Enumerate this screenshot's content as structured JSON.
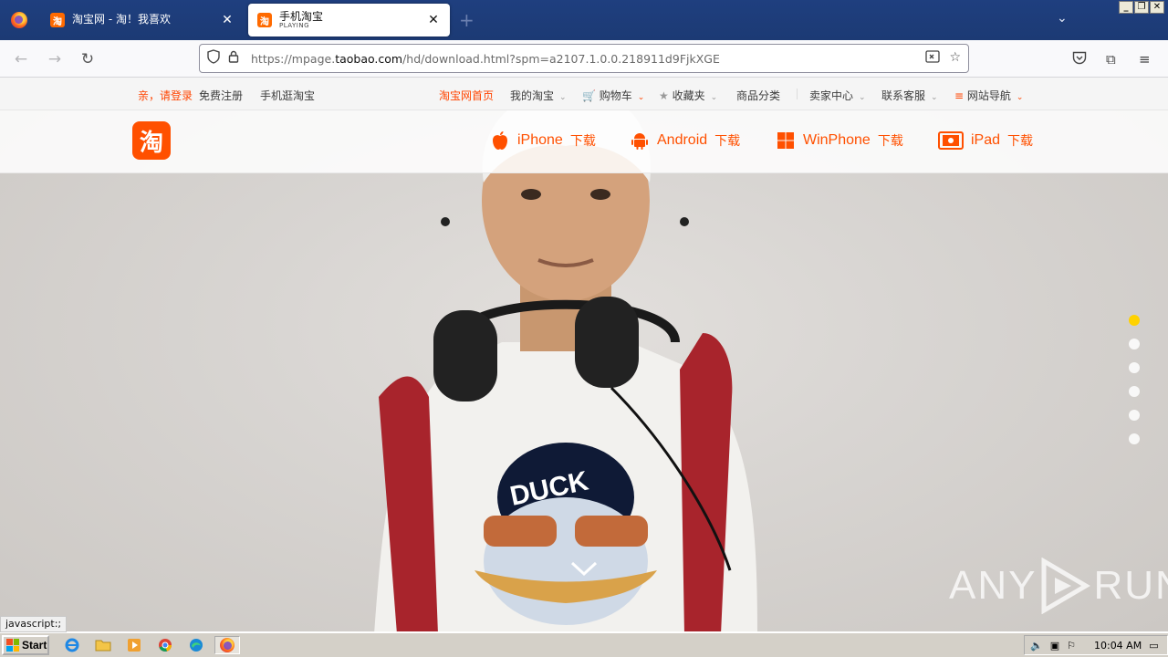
{
  "browser": {
    "tabs": [
      {
        "favicon": "淘",
        "title": "淘宝网 - 淘！我喜欢",
        "subtitle": ""
      },
      {
        "favicon": "淘",
        "title": "手机淘宝",
        "subtitle": "PLAYING"
      }
    ],
    "url": {
      "prefix": "https://mpage.",
      "domain": "taobao.com",
      "path": "/hd/download.html?spm=a2107.1.0.0.218911d9FjkXGE"
    }
  },
  "site": {
    "topbar": {
      "login": "亲，请登录",
      "register": "免费注册",
      "mobile": "手机逛淘宝",
      "home": "淘宝网首页",
      "my_taobao": "我的淘宝",
      "cart": "购物车",
      "favorites": "收藏夹",
      "categories": "商品分类",
      "seller": "卖家中心",
      "service": "联系客服",
      "sitenav": "网站导航"
    },
    "brand": "淘",
    "downloads": [
      {
        "label": "iPhone",
        "suffix": "下载",
        "icon": "apple-icon"
      },
      {
        "label": "Android",
        "suffix": "下载",
        "icon": "android-icon"
      },
      {
        "label": "WinPhone",
        "suffix": "下载",
        "icon": "windows-icon"
      },
      {
        "label": "iPad",
        "suffix": "下载",
        "icon": "ipad-icon"
      }
    ],
    "slides": {
      "count": 6,
      "active": 0
    }
  },
  "status_text": "javascript:;",
  "watermark": {
    "left": "ANY",
    "right": "RUN"
  },
  "taskbar": {
    "start": "Start",
    "clock": "10:04 AM"
  },
  "colors": {
    "accent": "#ff5000",
    "tab_bar": "#1f3f7f",
    "dot_active": "#ffd200"
  }
}
